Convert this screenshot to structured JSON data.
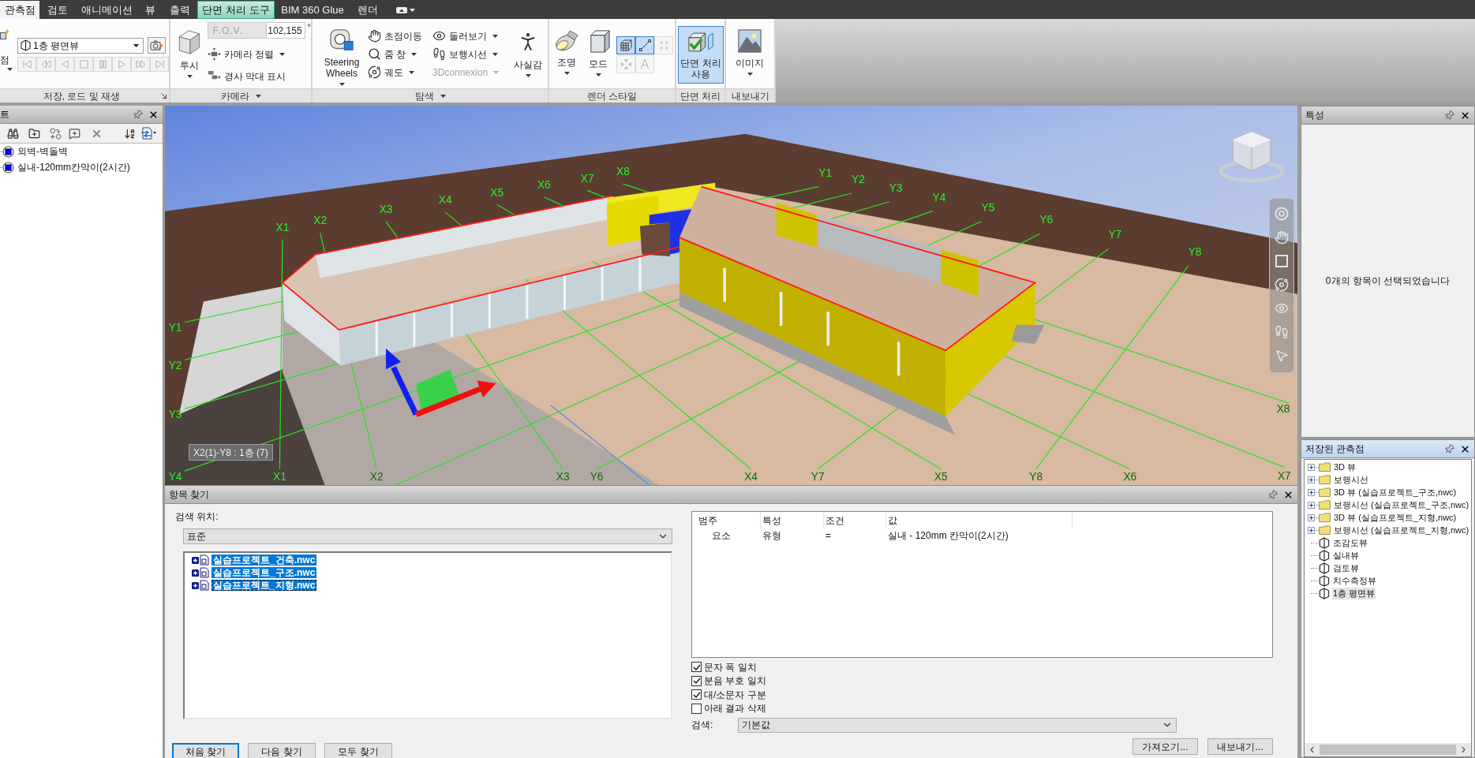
{
  "tabs": [
    {
      "label": "관측점",
      "selected": true,
      "contextual": false
    },
    {
      "label": "검토",
      "selected": false,
      "contextual": false
    },
    {
      "label": "애니메이션",
      "selected": false,
      "contextual": false
    },
    {
      "label": "뷰",
      "selected": false,
      "contextual": false
    },
    {
      "label": "출력",
      "selected": false,
      "contextual": false
    },
    {
      "label": "단면 처리 도구",
      "selected": false,
      "contextual": true
    },
    {
      "label": "BIM 360 Glue",
      "selected": false,
      "contextual": false
    },
    {
      "label": "렌더",
      "selected": false,
      "contextual": false
    }
  ],
  "ribbon": {
    "save_load_playback": {
      "title": "저장, 로드 및 재생",
      "launcher": true,
      "save_viewpoint": {
        "label": "점",
        "dropdown": true
      },
      "current_viewpoint": "1층 평면뷰",
      "playback_disabled": true
    },
    "camera": {
      "title": "카메라",
      "menu": true,
      "projection": {
        "label": "투시",
        "dropdown": true
      },
      "fov": {
        "label": "F.O.V.",
        "value": "102,155",
        "unit": "°",
        "disabled": true
      },
      "tools": [
        {
          "label": "카메라 정렬",
          "dropdown": true
        },
        {
          "label": "경사 막대 표시",
          "dropdown": false
        }
      ]
    },
    "navigate": {
      "title": "탐색",
      "menu": true,
      "steering_wheels": {
        "lines": [
          "Steering",
          "Wheels"
        ],
        "dropdown": true
      },
      "tools": [
        {
          "label": "초점이동",
          "dropdown": false,
          "disabled": false
        },
        {
          "label": "줌 창",
          "dropdown": true,
          "disabled": false
        },
        {
          "label": "궤도",
          "dropdown": true,
          "disabled": false
        },
        {
          "label": "둘러보기",
          "dropdown": true,
          "disabled": false
        },
        {
          "label": "보행시선",
          "dropdown": true,
          "disabled": false
        },
        {
          "label": "3Dconnexion",
          "dropdown": true,
          "disabled": true
        }
      ],
      "realism": {
        "label": "사실감",
        "dropdown": true
      }
    },
    "render_style": {
      "title": "렌더 스타일",
      "buttons": [
        {
          "label": "조명",
          "dropdown": true
        },
        {
          "label": "모드",
          "dropdown": true
        }
      ],
      "toggles": [
        {
          "selected": true,
          "disabled": false
        },
        {
          "selected": true,
          "disabled": false
        },
        {
          "selected": false,
          "disabled": true
        },
        {
          "selected": false,
          "disabled": true
        },
        {
          "label": "A",
          "selected": false,
          "disabled": true
        }
      ]
    },
    "sectioning": {
      "title": "단면 처리",
      "button": {
        "lines": [
          "단면 처리",
          "사용"
        ],
        "selected": true
      }
    },
    "export": {
      "title": "내보내기",
      "button": {
        "label": "이미지",
        "dropdown": true
      }
    }
  },
  "sets_panel": {
    "title": "트",
    "active": false,
    "items": [
      {
        "label": "외벽-벽돌벽",
        "selected": false
      },
      {
        "label": "실내-120mm칸막이(2시간)",
        "selected": false
      }
    ]
  },
  "viewport": {
    "grid_labels": [
      "X1",
      "X2",
      "X3",
      "X4",
      "X5",
      "X6",
      "X7",
      "X8",
      "Y1",
      "Y2",
      "Y3",
      "Y4",
      "Y5",
      "Y6",
      "Y7",
      "Y8",
      "Y1",
      "Y2",
      "Y3",
      "X8",
      "Y4",
      "X1",
      "X2",
      "X3",
      "Y6",
      "X4",
      "Y7",
      "X5",
      "Y8",
      "X6",
      "X7"
    ],
    "tag": "X2(1)-Y8 : 1층 (7)"
  },
  "find_items": {
    "title": "항목 찾기",
    "active": false,
    "search_in": {
      "label": "검색 위치:",
      "value": "표준"
    },
    "tree": [
      {
        "label": "실습프로젝트_건축.nwc",
        "selected": true,
        "expanded": false,
        "focused": false
      },
      {
        "label": "실습프로젝트_구조.nwc",
        "selected": true,
        "expanded": false,
        "focused": false
      },
      {
        "label": "실습프로젝트_지형.nwc",
        "selected": true,
        "expanded": false,
        "focused": true
      }
    ],
    "conditions": {
      "columns": [
        "범주",
        "특성",
        "조건",
        "값"
      ],
      "rows": [
        [
          "요소",
          "유형",
          "=",
          "실내 - 120mm 칸막이(2시간)"
        ]
      ]
    },
    "options": [
      {
        "label": "문자 폭 일치",
        "checked": true
      },
      {
        "label": "분음 부호 일치",
        "checked": true
      },
      {
        "label": "대/소문자 구분",
        "checked": true
      },
      {
        "label": "아래 결과 삭제",
        "checked": false
      }
    ],
    "search": {
      "label": "검색:",
      "value": "기본값"
    },
    "buttons": [
      {
        "label": "처음 찾기",
        "focused": true
      },
      {
        "label": "다음 찾기",
        "focused": false
      },
      {
        "label": "모두 찾기",
        "focused": false
      }
    ],
    "file_buttons": [
      "가져오기...",
      "내보내기..."
    ]
  },
  "properties": {
    "title": "특성",
    "active": false,
    "message": "0개의 항목이 선택되었습니다"
  },
  "saved_viewpoints": {
    "title": "저장된 관측점",
    "active": true,
    "items": [
      {
        "kind": "folder",
        "label": "3D 뷰",
        "expanded": false,
        "selected": false
      },
      {
        "kind": "folder",
        "label": "보행시선",
        "expanded": false,
        "selected": false
      },
      {
        "kind": "folder",
        "label": "3D 뷰 (실습프로젝트_구조,nwc)",
        "expanded": false,
        "selected": false
      },
      {
        "kind": "folder",
        "label": "보행시선 (실습프로젝트_구조,nwc)",
        "expanded": false,
        "selected": false
      },
      {
        "kind": "folder",
        "label": "3D 뷰 (실습프로젝트_지형,nwc)",
        "expanded": false,
        "selected": false
      },
      {
        "kind": "folder",
        "label": "보행시선 (실습프로젝트_지형,nwc)",
        "expanded": false,
        "selected": false
      },
      {
        "kind": "viewpoint",
        "label": "조감도뷰",
        "selected": false
      },
      {
        "kind": "viewpoint",
        "label": "실내뷰",
        "selected": false
      },
      {
        "kind": "viewpoint",
        "label": "검토뷰",
        "selected": false
      },
      {
        "kind": "viewpoint",
        "label": "치수측정뷰",
        "selected": false
      },
      {
        "kind": "viewpoint",
        "label": "1층 평면뷰",
        "selected": true
      }
    ]
  }
}
